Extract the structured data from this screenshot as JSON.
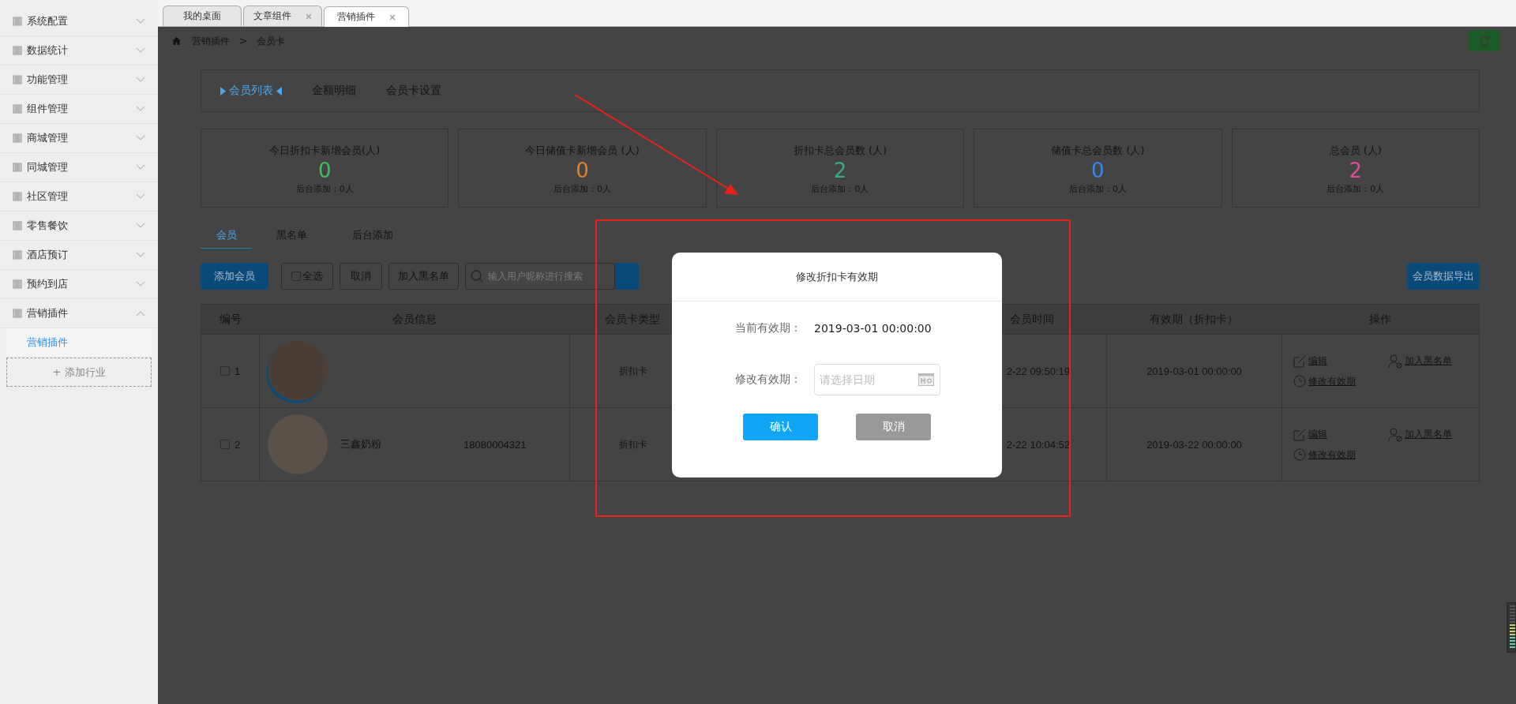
{
  "top_tabs": [
    {
      "label": "我的桌面",
      "closable": false,
      "selected": false
    },
    {
      "label": "文章组件",
      "closable": true,
      "selected": false
    },
    {
      "label": "营销插件",
      "closable": true,
      "selected": true
    }
  ],
  "sidebar": {
    "items": [
      {
        "label": "系统配置",
        "expanded": false
      },
      {
        "label": "数据统计",
        "expanded": false
      },
      {
        "label": "功能管理",
        "expanded": false
      },
      {
        "label": "组件管理",
        "expanded": false
      },
      {
        "label": "商城管理",
        "expanded": false
      },
      {
        "label": "同城管理",
        "expanded": false
      },
      {
        "label": "社区管理",
        "expanded": false
      },
      {
        "label": "零售餐饮",
        "expanded": false
      },
      {
        "label": "酒店预订",
        "expanded": false
      },
      {
        "label": "预约到店",
        "expanded": false
      },
      {
        "label": "营销插件",
        "expanded": true,
        "children": [
          {
            "label": "营销插件",
            "selected": true
          }
        ]
      }
    ],
    "add_button": "+ 添加行业"
  },
  "breadcrumb": [
    "营销插件",
    ">",
    "会员卡"
  ],
  "section_tabs": [
    {
      "label": "会员列表",
      "selected": true
    },
    {
      "label": "金额明细",
      "selected": false
    },
    {
      "label": "会员卡设置",
      "selected": false
    }
  ],
  "stats": [
    {
      "title": "今日折扣卡新增会员(人)",
      "value": "0",
      "color": "#3fbf5f",
      "note": "后台添加：0人"
    },
    {
      "title": "今日储值卡新增会员 (人)",
      "value": "0",
      "color": "#e0802a",
      "note": "后台添加：0人"
    },
    {
      "title": "折扣卡总会员数 (人)",
      "value": "2",
      "color": "#3aaa80",
      "note": "后台添加：0人"
    },
    {
      "title": "储值卡总会员数 (人)",
      "value": "0",
      "color": "#3a85f0",
      "note": "后台添加：0人"
    },
    {
      "title": "总会员 (人)",
      "value": "2",
      "color": "#e04a9a",
      "note": "后台添加：0人"
    }
  ],
  "member_tabs": [
    {
      "label": "会员",
      "selected": true
    },
    {
      "label": "黑名单",
      "selected": false
    },
    {
      "label": "后台添加",
      "selected": false
    }
  ],
  "toolbar": {
    "add_button": "添加会员",
    "select_all": {
      "label": "全选",
      "checked": false
    },
    "cancel_button": "取消",
    "blacklist_button": "加入黑名单",
    "search": {
      "placeholder": "输入用户昵称进行搜索"
    },
    "export_button": "会员数据导出"
  },
  "table": {
    "columns": [
      "编号",
      "会员信息",
      "会员卡类型",
      "会员时间",
      "有效期（折扣卡）",
      "操作"
    ],
    "rows": [
      {
        "checked": false,
        "number": "1",
        "card_type": "折扣卡",
        "time": "2-22 09:50:19",
        "expiry": "2019-03-01 00:00:00",
        "actions": [
          "编辑",
          "加入黑名单",
          "修改有效期"
        ]
      },
      {
        "checked": false,
        "number": "2",
        "name": "三鑫奶粉",
        "phone": "18080004321",
        "card_type": "折扣卡",
        "time": "2-22 10:04:52",
        "expiry": "2019-03-22 00:00:00",
        "actions": [
          "编辑",
          "加入黑名单",
          "修改有效期"
        ]
      }
    ]
  },
  "dialog": {
    "title": "修改折扣卡有效期",
    "fields": [
      {
        "kind": "text",
        "label": "当前有效期：",
        "value": "2019-03-01 00:00:00"
      },
      {
        "kind": "date",
        "label": "修改有效期：",
        "placeholder": "请选择日期"
      }
    ],
    "buttons": [
      {
        "label": "确认",
        "kind": "primary"
      },
      {
        "label": "取消",
        "kind": "secondary"
      }
    ]
  }
}
